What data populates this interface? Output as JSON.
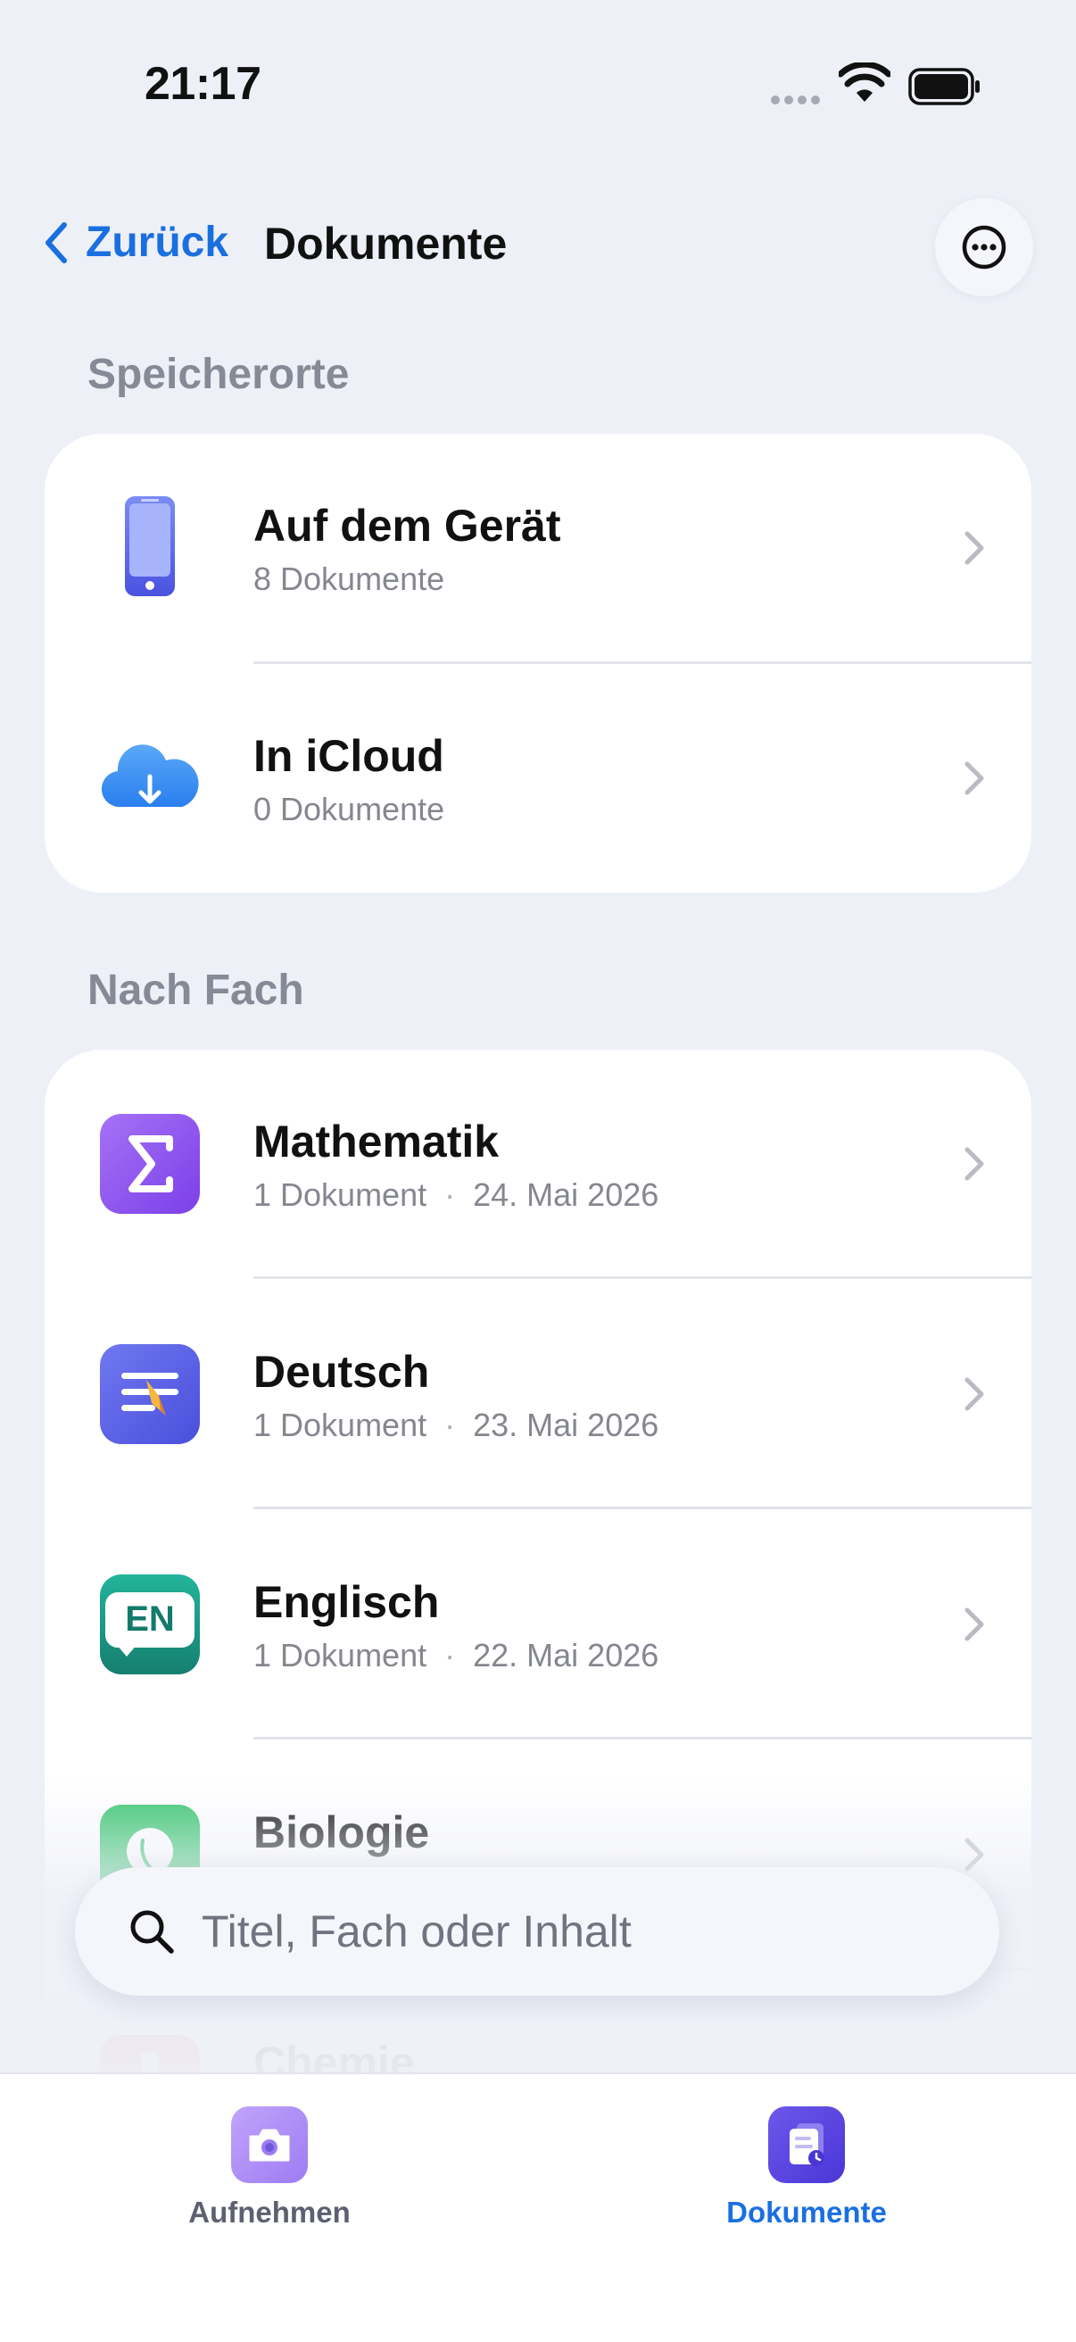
{
  "status_bar": {
    "time": "21:17"
  },
  "nav": {
    "back_label": "Zurück",
    "title": "Dokumente"
  },
  "sections": {
    "locations": {
      "header": "Speicherorte",
      "items": [
        {
          "title": "Auf dem Gerät",
          "count": "8 Dokumente",
          "icon": "phone-icon"
        },
        {
          "title": "In iCloud",
          "count": "0 Dokumente",
          "icon": "cloud-download-icon"
        }
      ]
    },
    "subjects": {
      "header": "Nach Fach",
      "items": [
        {
          "title": "Mathematik",
          "count": "1 Dokument",
          "date": "24. Mai 2026",
          "icon": "sigma-icon",
          "color": "#8b5cf6"
        },
        {
          "title": "Deutsch",
          "count": "1 Dokument",
          "date": "23. Mai 2026",
          "icon": "text-pencil-icon",
          "color": "#5b62e8"
        },
        {
          "title": "Englisch",
          "count": "1 Dokument",
          "date": "22. Mai 2026",
          "icon": "en-speech-bubble-icon",
          "icon_text": "EN",
          "color": "#1a9b86"
        },
        {
          "title": "Biologie",
          "icon": "leaf-icon",
          "color": "#34c46b"
        },
        {
          "title": "Chemie",
          "icon": "flask-icon",
          "color": "#e26a5a"
        }
      ]
    }
  },
  "search": {
    "placeholder": "Titel, Fach oder Inhalt"
  },
  "tab_bar": {
    "tabs": [
      {
        "label": "Aufnehmen",
        "icon": "camera-icon",
        "active": false
      },
      {
        "label": "Dokumente",
        "icon": "documents-icon",
        "active": true
      }
    ]
  },
  "colors": {
    "accent": "#1a6fe0",
    "background": "#eef0f8",
    "secondary_text": "#85878f"
  }
}
